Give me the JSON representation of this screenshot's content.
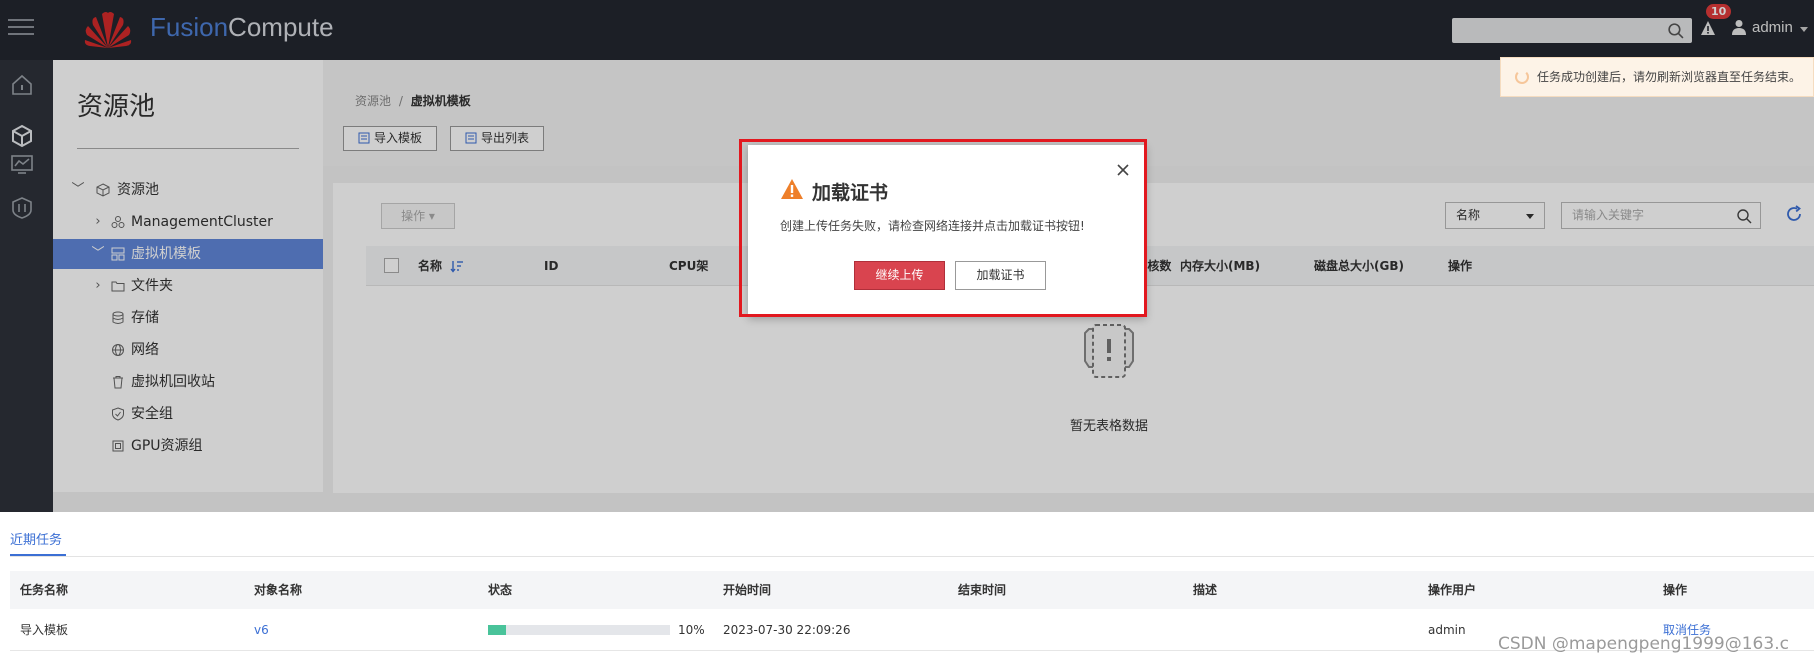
{
  "header": {
    "brand_part1": "Fusion",
    "brand_part2": "Compute",
    "alarm_count": "10",
    "user": "admin"
  },
  "sidebar": {
    "title": "资源池",
    "items": [
      {
        "label": "资源池",
        "icon": "cube-icon",
        "expanded": true
      },
      {
        "label": "ManagementCluster",
        "icon": "cluster-icon",
        "expanded": false
      },
      {
        "label": "虚拟机模板",
        "icon": "template-icon",
        "expanded": true,
        "selected": true
      },
      {
        "label": "文件夹",
        "icon": "folder-icon",
        "expanded": false
      },
      {
        "label": "存储",
        "icon": "database-icon"
      },
      {
        "label": "网络",
        "icon": "globe-icon"
      },
      {
        "label": "虚拟机回收站",
        "icon": "trash-icon"
      },
      {
        "label": "安全组",
        "icon": "shield-icon"
      },
      {
        "label": "GPU资源组",
        "icon": "gpu-icon"
      }
    ]
  },
  "main": {
    "breadcrumb_root": "资源池",
    "breadcrumb_sep": "/",
    "breadcrumb_current": "虚拟机模板",
    "import_label": "导入模板",
    "export_label": "导出列表",
    "actions_label": "操作 ▾",
    "filter_select": "名称",
    "filter_placeholder": "请输入关键字",
    "columns": [
      "名称",
      "ID",
      "CPU架",
      "CPU核数",
      "内存大小(MB)",
      "磁盘总大小(GB)",
      "操作"
    ],
    "empty_text": "暂无表格数据"
  },
  "toast": {
    "text": "任务成功创建后，请勿刷新浏览器直至任务结束。"
  },
  "dialog": {
    "title": "加载证书",
    "message": "创建上传任务失败，请检查网络连接并点击加载证书按钮!",
    "primary": "继续上传",
    "secondary": "加载证书"
  },
  "tasks": {
    "tab": "近期任务",
    "columns": [
      "任务名称",
      "对象名称",
      "状态",
      "开始时间",
      "结束时间",
      "描述",
      "操作用户",
      "操作"
    ],
    "rows": [
      {
        "name": "导入模板",
        "object": "v6",
        "progress": 10,
        "progress_text": "10%",
        "start": "2023-07-30 22:09:26",
        "end": "",
        "desc": "",
        "user": "admin",
        "action": "取消任务"
      }
    ]
  },
  "watermark": "CSDN @mapengpeng1999@163.c",
  "colors": {
    "topbar": "#23272f",
    "selected": "#6187d9",
    "primary_button": "#d9444f",
    "link": "#3b6fd4",
    "progress": "#49c39a",
    "highlight_frame": "#e2181f"
  }
}
